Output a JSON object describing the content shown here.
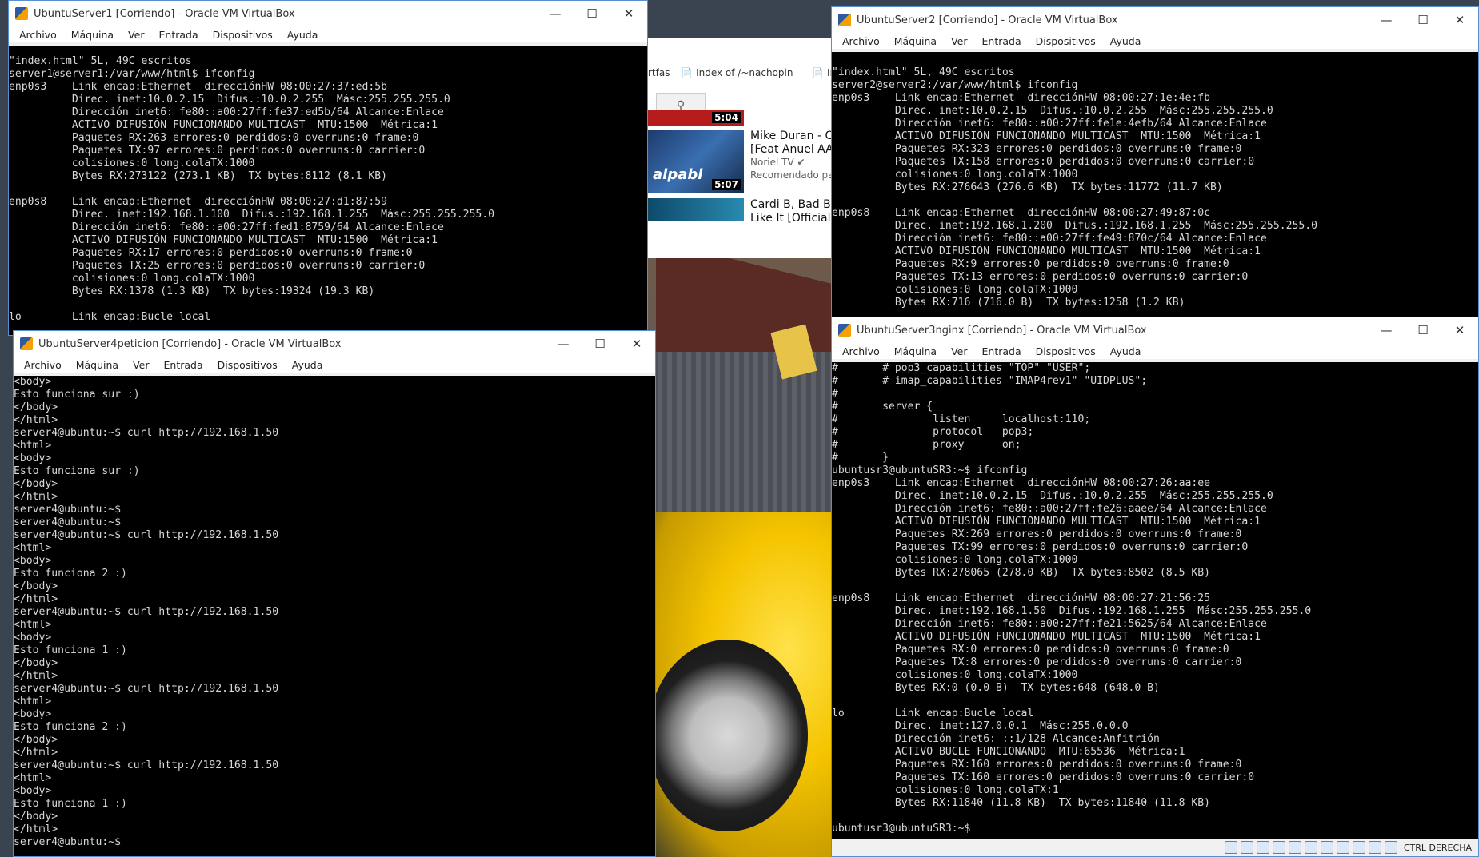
{
  "browser": {
    "bookmarks": [
      "rtfas",
      "Index of /~nachopin",
      "Ind"
    ],
    "videos": [
      {
        "duration": "5:04",
        "title1": "",
        "title2": ""
      },
      {
        "duration": "5:07",
        "title1": "Mike Duran - Culp",
        "title2": "[Feat Anuel AA, Ño",
        "channel": "Noriel TV",
        "meta": "Recomendado para"
      },
      {
        "duration": "",
        "title1": "Cardi B, Bad Bunn",
        "title2": "Like It [Official Au"
      }
    ],
    "thumb_label": "alpabl"
  },
  "menu": [
    "Archivo",
    "Máquina",
    "Ver",
    "Entrada",
    "Dispositivos",
    "Ayuda"
  ],
  "status_label": "CTRL DERECHA",
  "windows": {
    "server1": {
      "title": "UbuntuServer1 [Corriendo] - Oracle VM VirtualBox",
      "lines": [
        "\"index.html\" 5L, 49C escritos",
        "server1@server1:/var/www/html$ ifconfig",
        "enp0s3    Link encap:Ethernet  direcciónHW 08:00:27:37:ed:5b",
        "          Direc. inet:10.0.2.15  Difus.:10.0.2.255  Másc:255.255.255.0",
        "          Dirección inet6: fe80::a00:27ff:fe37:ed5b/64 Alcance:Enlace",
        "          ACTIVO DIFUSIÓN FUNCIONANDO MULTICAST  MTU:1500  Métrica:1",
        "          Paquetes RX:263 errores:0 perdidos:0 overruns:0 frame:0",
        "          Paquetes TX:97 errores:0 perdidos:0 overruns:0 carrier:0",
        "          colisiones:0 long.colaTX:1000",
        "          Bytes RX:273122 (273.1 KB)  TX bytes:8112 (8.1 KB)",
        "",
        "enp0s8    Link encap:Ethernet  direcciónHW 08:00:27:d1:87:59",
        "          Direc. inet:192.168.1.100  Difus.:192.168.1.255  Másc:255.255.255.0",
        "          Dirección inet6: fe80::a00:27ff:fed1:8759/64 Alcance:Enlace",
        "          ACTIVO DIFUSIÓN FUNCIONANDO MULTICAST  MTU:1500  Métrica:1",
        "          Paquetes RX:17 errores:0 perdidos:0 overruns:0 frame:0",
        "          Paquetes TX:25 errores:0 perdidos:0 overruns:0 carrier:0",
        "          colisiones:0 long.colaTX:1000",
        "          Bytes RX:1378 (1.3 KB)  TX bytes:19324 (19.3 KB)",
        "",
        "lo        Link encap:Bucle local"
      ]
    },
    "server2": {
      "title": "UbuntuServer2 [Corriendo] - Oracle VM VirtualBox",
      "lines": [
        "\"index.html\" 5L, 49C escritos",
        "server2@server2:/var/www/html$ ifconfig",
        "enp0s3    Link encap:Ethernet  direcciónHW 08:00:27:1e:4e:fb",
        "          Direc. inet:10.0.2.15  Difus.:10.0.2.255  Másc:255.255.255.0",
        "          Dirección inet6: fe80::a00:27ff:fe1e:4efb/64 Alcance:Enlace",
        "          ACTIVO DIFUSIÓN FUNCIONANDO MULTICAST  MTU:1500  Métrica:1",
        "          Paquetes RX:323 errores:0 perdidos:0 overruns:0 frame:0",
        "          Paquetes TX:158 errores:0 perdidos:0 overruns:0 carrier:0",
        "          colisiones:0 long.colaTX:1000",
        "          Bytes RX:276643 (276.6 KB)  TX bytes:11772 (11.7 KB)",
        "",
        "enp0s8    Link encap:Ethernet  direcciónHW 08:00:27:49:87:0c",
        "          Direc. inet:192.168.1.200  Difus.:192.168.1.255  Másc:255.255.255.0",
        "          Dirección inet6: fe80::a00:27ff:fe49:870c/64 Alcance:Enlace",
        "          ACTIVO DIFUSIÓN FUNCIONANDO MULTICAST  MTU:1500  Métrica:1",
        "          Paquetes RX:9 errores:0 perdidos:0 overruns:0 frame:0",
        "          Paquetes TX:13 errores:0 perdidos:0 overruns:0 carrier:0",
        "          colisiones:0 long.colaTX:1000",
        "          Bytes RX:716 (716.0 B)  TX bytes:1258 (1.2 KB)"
      ]
    },
    "server3": {
      "title": "UbuntuServer3nginx [Corriendo] - Oracle VM VirtualBox",
      "lines": [
        "#       # pop3_capabilities \"TOP\" \"USER\";",
        "#       # imap_capabilities \"IMAP4rev1\" \"UIDPLUS\";",
        "#",
        "#       server {",
        "#               listen     localhost:110;",
        "#               protocol   pop3;",
        "#               proxy      on;",
        "#       }",
        "ubuntusr3@ubuntuSR3:~$ ifconfig",
        "enp0s3    Link encap:Ethernet  direcciónHW 08:00:27:26:aa:ee",
        "          Direc. inet:10.0.2.15  Difus.:10.0.2.255  Másc:255.255.255.0",
        "          Dirección inet6: fe80::a00:27ff:fe26:aaee/64 Alcance:Enlace",
        "          ACTIVO DIFUSIÓN FUNCIONANDO MULTICAST  MTU:1500  Métrica:1",
        "          Paquetes RX:269 errores:0 perdidos:0 overruns:0 frame:0",
        "          Paquetes TX:99 errores:0 perdidos:0 overruns:0 carrier:0",
        "          colisiones:0 long.colaTX:1000",
        "          Bytes RX:278065 (278.0 KB)  TX bytes:8502 (8.5 KB)",
        "",
        "enp0s8    Link encap:Ethernet  direcciónHW 08:00:27:21:56:25",
        "          Direc. inet:192.168.1.50  Difus.:192.168.1.255  Másc:255.255.255.0",
        "          Dirección inet6: fe80::a00:27ff:fe21:5625/64 Alcance:Enlace",
        "          ACTIVO DIFUSIÓN FUNCIONANDO MULTICAST  MTU:1500  Métrica:1",
        "          Paquetes RX:0 errores:0 perdidos:0 overruns:0 frame:0",
        "          Paquetes TX:8 errores:0 perdidos:0 overruns:0 carrier:0",
        "          colisiones:0 long.colaTX:1000",
        "          Bytes RX:0 (0.0 B)  TX bytes:648 (648.0 B)",
        "",
        "lo        Link encap:Bucle local",
        "          Direc. inet:127.0.0.1  Másc:255.0.0.0",
        "          Dirección inet6: ::1/128 Alcance:Anfitrión",
        "          ACTIVO BUCLE FUNCIONANDO  MTU:65536  Métrica:1",
        "          Paquetes RX:160 errores:0 perdidos:0 overruns:0 frame:0",
        "          Paquetes TX:160 errores:0 perdidos:0 overruns:0 carrier:0",
        "          colisiones:0 long.colaTX:1",
        "          Bytes RX:11840 (11.8 KB)  TX bytes:11840 (11.8 KB)",
        "",
        "ubuntusr3@ubuntuSR3:~$"
      ]
    },
    "server4": {
      "title": "UbuntuServer4peticion [Corriendo] - Oracle VM VirtualBox",
      "lines": [
        "<body>",
        "Esto funciona sur :)",
        "</body>",
        "</html>",
        "server4@ubuntu:~$ curl http://192.168.1.50",
        "<html>",
        "<body>",
        "Esto funciona sur :)",
        "</body>",
        "</html>",
        "server4@ubuntu:~$",
        "server4@ubuntu:~$",
        "server4@ubuntu:~$ curl http://192.168.1.50",
        "<html>",
        "<body>",
        "Esto funciona 2 :)",
        "</body>",
        "</html>",
        "server4@ubuntu:~$ curl http://192.168.1.50",
        "<html>",
        "<body>",
        "Esto funciona 1 :)",
        "</body>",
        "</html>",
        "server4@ubuntu:~$ curl http://192.168.1.50",
        "<html>",
        "<body>",
        "Esto funciona 2 :)",
        "</body>",
        "</html>",
        "server4@ubuntu:~$ curl http://192.168.1.50",
        "<html>",
        "<body>",
        "Esto funciona 1 :)",
        "</body>",
        "</html>",
        "server4@ubuntu:~$"
      ]
    }
  }
}
